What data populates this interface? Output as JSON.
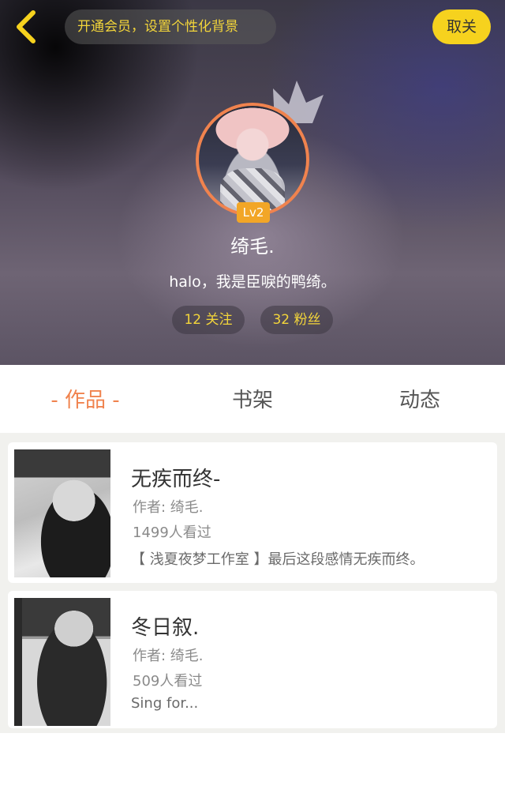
{
  "header": {
    "back_icon": "chevron-left-icon",
    "promo_text": "开通会员，设置个性化背景",
    "unfollow_label": "取关"
  },
  "profile": {
    "level": "Lv2",
    "username": "绮毛.",
    "bio": "halo，我是臣唳的鸭绮。",
    "following_label": "12 关注",
    "fans_label": "32 粉丝"
  },
  "tabs": [
    {
      "label": "作品",
      "active": true
    },
    {
      "label": "书架",
      "active": false
    },
    {
      "label": "动态",
      "active": false
    }
  ],
  "works": [
    {
      "title": "无疾而终-",
      "author": "作者: 绮毛.",
      "views": "1499人看过",
      "description": "【 浅夏夜梦工作室 】最后这段感情无疾而终。"
    },
    {
      "title": "冬日叙.",
      "author": "作者: 绮毛.",
      "views": "509人看过",
      "description": "Sing for..."
    }
  ],
  "colors": {
    "accent": "#f0834e",
    "yellow": "#f6d21e",
    "promo_text": "#f3d53a",
    "level_badge": "#f2a627"
  }
}
